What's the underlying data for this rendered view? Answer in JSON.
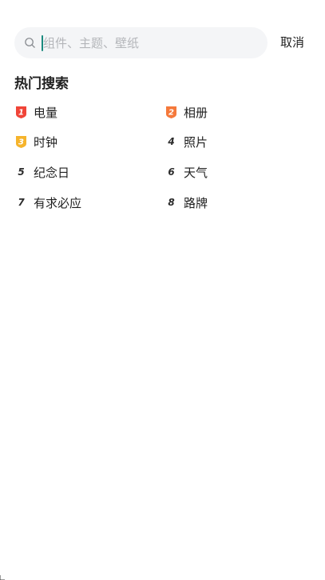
{
  "search": {
    "placeholder": "组件、主题、壁纸",
    "value": "",
    "cancel_label": "取消"
  },
  "hot": {
    "title": "热门搜索",
    "items": [
      {
        "rank": "1",
        "label": "电量",
        "badge": true,
        "badge_color": "#f04438"
      },
      {
        "rank": "2",
        "label": "相册",
        "badge": true,
        "badge_color": "#f5793b"
      },
      {
        "rank": "3",
        "label": "时钟",
        "badge": true,
        "badge_color": "#f6b42c"
      },
      {
        "rank": "4",
        "label": "照片",
        "badge": false
      },
      {
        "rank": "5",
        "label": "纪念日",
        "badge": false
      },
      {
        "rank": "6",
        "label": "天气",
        "badge": false
      },
      {
        "rank": "7",
        "label": "有求必应",
        "badge": false
      },
      {
        "rank": "8",
        "label": "路牌",
        "badge": false
      }
    ]
  },
  "colors": {
    "caret": "#1a8a7e",
    "search_bg": "#f4f5f7",
    "placeholder": "#b4b6ba"
  }
}
